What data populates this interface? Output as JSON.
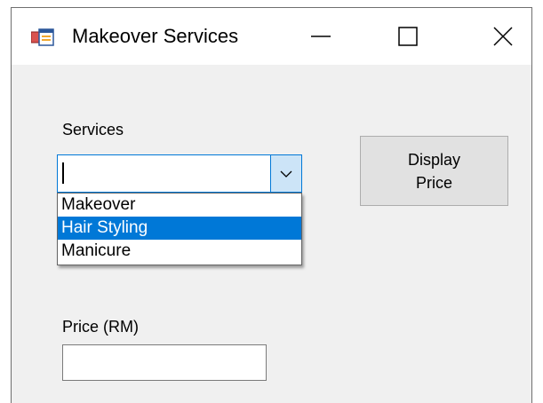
{
  "window": {
    "title": "Makeover Services",
    "controls": {
      "minimize_icon": "minimize-icon",
      "maximize_icon": "maximize-icon",
      "close_icon": "close-icon"
    }
  },
  "form": {
    "services_label": "Services",
    "services_combo": {
      "value": "",
      "options": [
        "Makeover",
        "Hair Styling",
        "Manicure"
      ],
      "highlighted_option": "Hair Styling"
    },
    "display_button": {
      "line1": "Display",
      "line2": "Price"
    },
    "price_label": "Price (RM)",
    "price_value": ""
  },
  "colors": {
    "accent": "#0078d7",
    "window_bg": "#f0f0f0",
    "titlebar_bg": "#ffffff",
    "button_bg": "#e1e1e1",
    "combo_button_bg": "#cce4f7"
  }
}
